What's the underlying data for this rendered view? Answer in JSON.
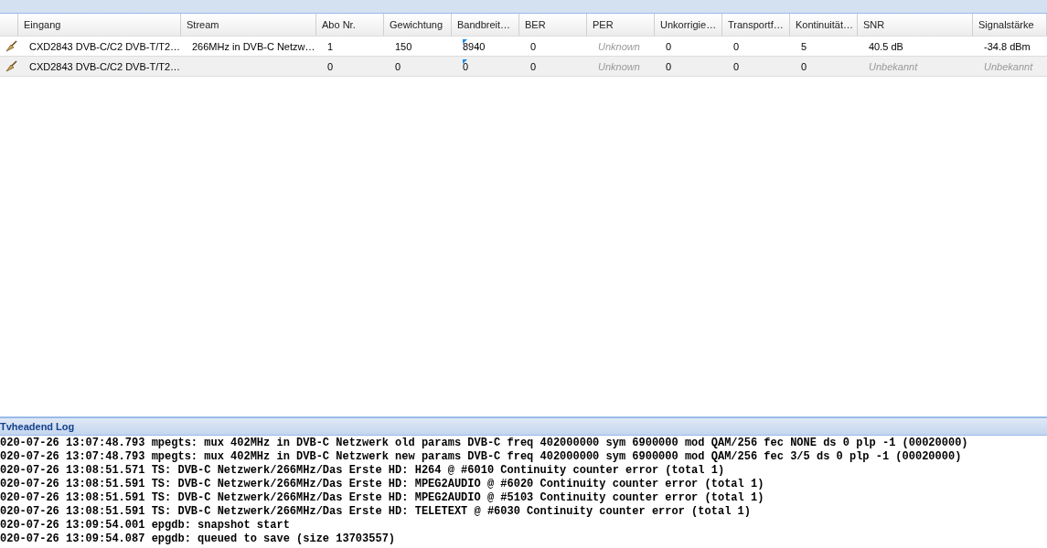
{
  "table": {
    "columns": [
      "Eingang",
      "Stream",
      "Abo Nr.",
      "Gewichtung",
      "Bandbreit…",
      "BER",
      "PER",
      "Unkorrigie…",
      "Transportf…",
      "Kontinuität…",
      "SNR",
      "Signalstärke"
    ],
    "rows": [
      {
        "cells": [
          {
            "text": "CXD2843 DVB-C/C2 DVB-T/T2…",
            "unknown": false
          },
          {
            "text": "266MHz in DVB-C Netzw…",
            "unknown": false
          },
          {
            "text": "1",
            "unknown": false
          },
          {
            "text": "150",
            "unknown": false
          },
          {
            "text": "8940",
            "unknown": false,
            "marked": true
          },
          {
            "text": "0",
            "unknown": false
          },
          {
            "text": "Unknown",
            "unknown": true
          },
          {
            "text": "0",
            "unknown": false
          },
          {
            "text": "0",
            "unknown": false
          },
          {
            "text": "5",
            "unknown": false
          },
          {
            "text": "40.5 dB",
            "unknown": false
          },
          {
            "text": "-34.8 dBm",
            "unknown": false
          }
        ]
      },
      {
        "cells": [
          {
            "text": "CXD2843 DVB-C/C2 DVB-T/T2…",
            "unknown": false
          },
          {},
          {
            "text": "0",
            "unknown": false
          },
          {
            "text": "0",
            "unknown": false
          },
          {
            "text": "0",
            "unknown": false,
            "marked": true
          },
          {
            "text": "0",
            "unknown": false
          },
          {
            "text": "Unknown",
            "unknown": true
          },
          {
            "text": "0",
            "unknown": false
          },
          {
            "text": "0",
            "unknown": false
          },
          {
            "text": "0",
            "unknown": false
          },
          {
            "text": "Unbekannt",
            "unknown": true
          },
          {
            "text": "Unbekannt",
            "unknown": true
          }
        ]
      }
    ]
  },
  "log": {
    "title": "Tvheadend Log",
    "lines": [
      "020-07-26 13:07:48.793 mpegts: mux 402MHz in DVB-C Netzwerk old params DVB-C freq 402000000 sym 6900000 mod QAM/256 fec NONE ds 0 plp -1 (00020000)",
      "020-07-26 13:07:48.793 mpegts: mux 402MHz in DVB-C Netzwerk new params DVB-C freq 402000000 sym 6900000 mod QAM/256 fec 3/5 ds 0 plp -1 (00020000)",
      "020-07-26 13:08:51.571 TS: DVB-C Netzwerk/266MHz/Das Erste HD: H264 @ #6010 Continuity counter error (total 1)",
      "020-07-26 13:08:51.591 TS: DVB-C Netzwerk/266MHz/Das Erste HD: MPEG2AUDIO @ #6020 Continuity counter error (total 1)",
      "020-07-26 13:08:51.591 TS: DVB-C Netzwerk/266MHz/Das Erste HD: MPEG2AUDIO @ #5103 Continuity counter error (total 1)",
      "020-07-26 13:08:51.591 TS: DVB-C Netzwerk/266MHz/Das Erste HD: TELETEXT @ #6030 Continuity counter error (total 1)",
      "020-07-26 13:09:54.001 epgdb: snapshot start",
      "020-07-26 13:09:54.087 epgdb: queued to save (size 13703557)"
    ]
  }
}
